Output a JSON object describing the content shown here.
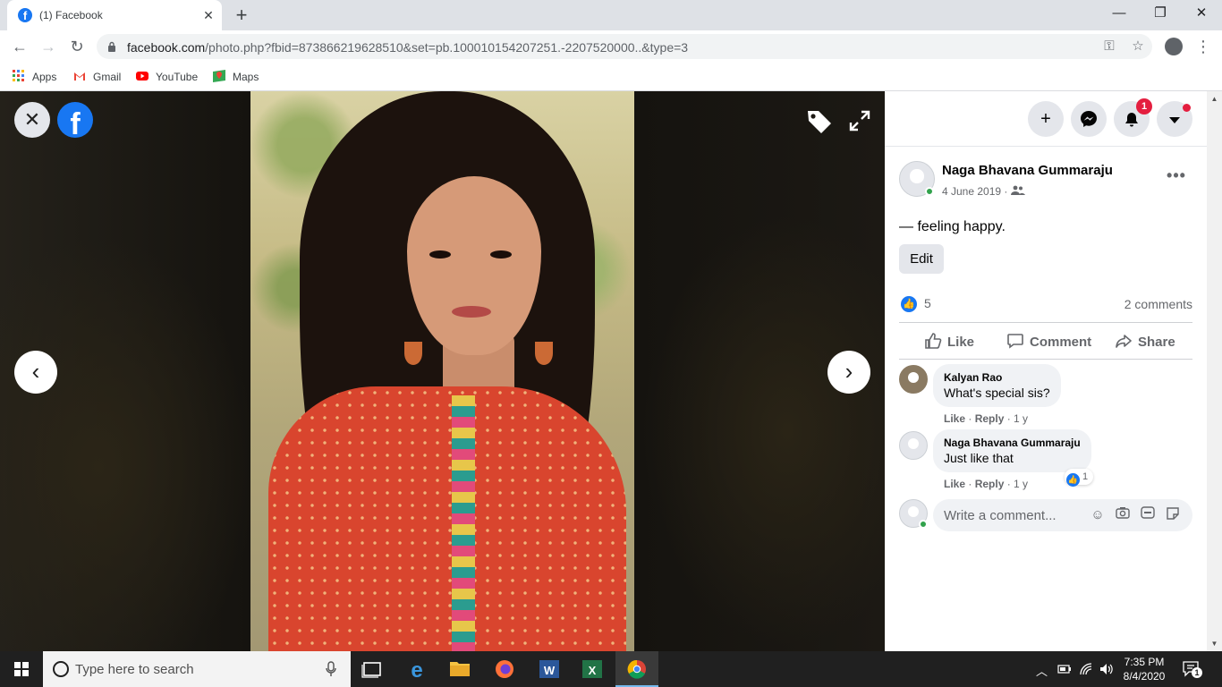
{
  "browser": {
    "tab_title": "(1) Facebook",
    "tab_favicon_letter": "f",
    "new_tab_symbol": "+",
    "tab_close_symbol": "✕",
    "url_host": "facebook.com",
    "url_path": "/photo.php?fbid=873866219628510&set=pb.100010154207251.-2207520000..&type=3",
    "window_controls": {
      "minimize": "—",
      "restore": "❐",
      "close": "✕"
    },
    "bookmarks": [
      {
        "label": "Apps",
        "icon": "apps-grid-icon"
      },
      {
        "label": "Gmail",
        "icon": "gmail-icon"
      },
      {
        "label": "YouTube",
        "icon": "youtube-icon"
      },
      {
        "label": "Maps",
        "icon": "maps-icon"
      }
    ]
  },
  "viewer": {
    "close_symbol": "✕",
    "logo_letter": "f",
    "prev_symbol": "‹",
    "next_symbol": "›"
  },
  "post": {
    "author": "Naga Bhavana Gummaraju",
    "date": "4 June 2019 · ",
    "feeling": "— feeling happy.",
    "edit_label": "Edit",
    "like_count": "5",
    "comment_count": "2 comments",
    "actions": {
      "like": "Like",
      "comment": "Comment",
      "share": "Share"
    },
    "notification_badge": "1",
    "more_symbol": "•••"
  },
  "comments": [
    {
      "name": "Kalyan Rao",
      "text": "What's special sis?",
      "like": "Like",
      "reply": "Reply",
      "age": "1 y"
    },
    {
      "name": "Naga Bhavana Gummaraju",
      "text": "Just like that",
      "like": "Like",
      "reply": "Reply",
      "age": "1 y",
      "likes": "1"
    }
  ],
  "composer": {
    "placeholder": "Write a comment..."
  },
  "taskbar": {
    "search_placeholder": "Type here to search",
    "time": "7:35 PM",
    "date": "8/4/2020",
    "notification_count": "1"
  },
  "colors": {
    "facebook_blue": "#1877f2",
    "badge_red": "#e41e3f",
    "online_green": "#31a24c"
  }
}
